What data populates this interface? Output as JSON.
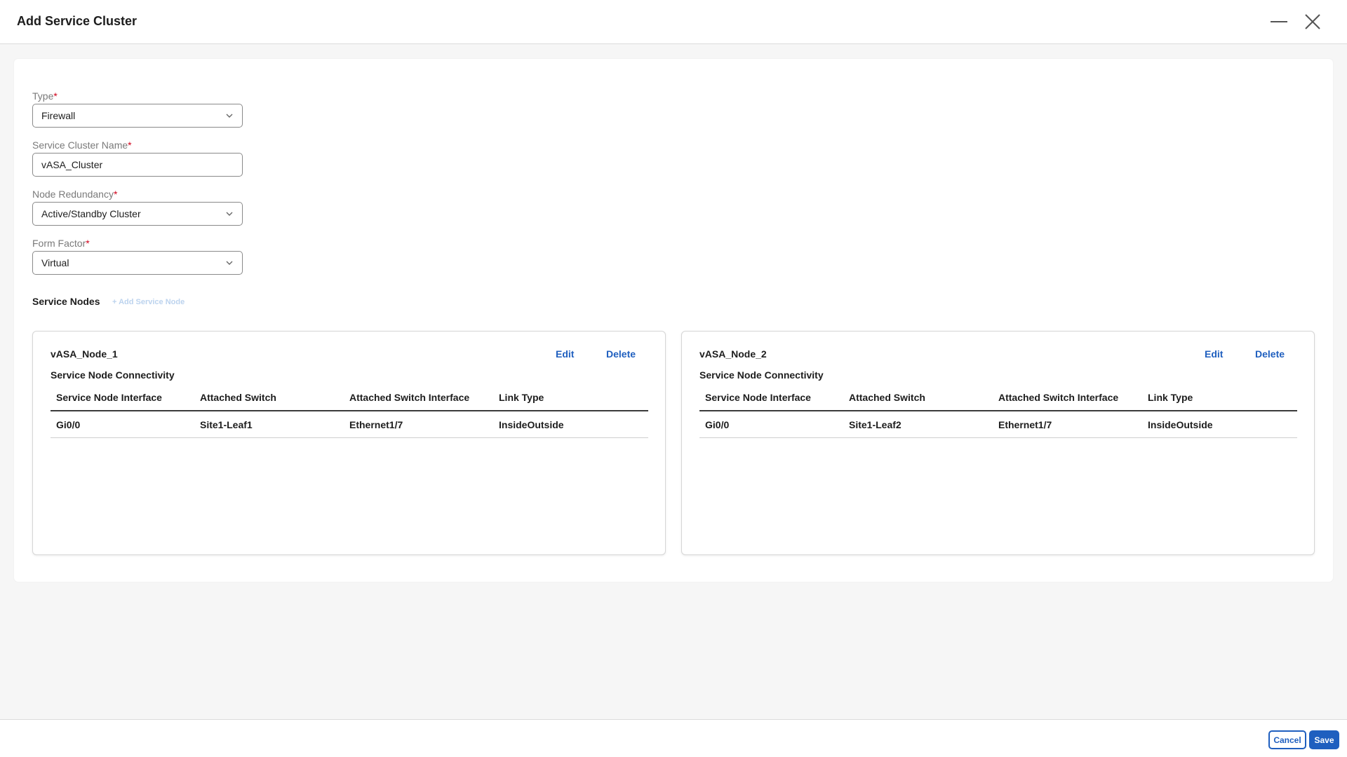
{
  "header": {
    "title": "Add Service Cluster"
  },
  "form": {
    "type": {
      "label": "Type",
      "required_mark": "*",
      "value": "Firewall"
    },
    "cluster_name": {
      "label": "Service Cluster Name",
      "required_mark": "*",
      "value": "vASA_Cluster"
    },
    "node_redundancy": {
      "label": "Node Redundancy",
      "required_mark": "*",
      "value": "Active/Standby Cluster"
    },
    "form_factor": {
      "label": "Form Factor",
      "required_mark": "*",
      "value": "Virtual"
    }
  },
  "service_nodes": {
    "title": "Service Nodes",
    "add_label": "+ Add Service Node",
    "nodes": [
      {
        "name": "vASA_Node_1",
        "edit_label": "Edit",
        "delete_label": "Delete",
        "connectivity_title": "Service Node Connectivity",
        "columns": [
          "Service Node Interface",
          "Attached Switch",
          "Attached Switch Interface",
          "Link Type"
        ],
        "rows": [
          [
            "Gi0/0",
            "Site1-Leaf1",
            "Ethernet1/7",
            "InsideOutside"
          ]
        ]
      },
      {
        "name": "vASA_Node_2",
        "edit_label": "Edit",
        "delete_label": "Delete",
        "connectivity_title": "Service Node Connectivity",
        "columns": [
          "Service Node Interface",
          "Attached Switch",
          "Attached Switch Interface",
          "Link Type"
        ],
        "rows": [
          [
            "Gi0/0",
            "Site1-Leaf2",
            "Ethernet1/7",
            "InsideOutside"
          ]
        ]
      }
    ]
  },
  "footer": {
    "cancel_label": "Cancel",
    "save_label": "Save"
  },
  "icons": {
    "minimize": "minimize-icon",
    "close": "close-icon",
    "chevron": "chevron-down-icon"
  },
  "colors": {
    "accent": "#1f5fbf",
    "required": "#d0021b",
    "add_link_disabled": "#bcd3ee"
  }
}
